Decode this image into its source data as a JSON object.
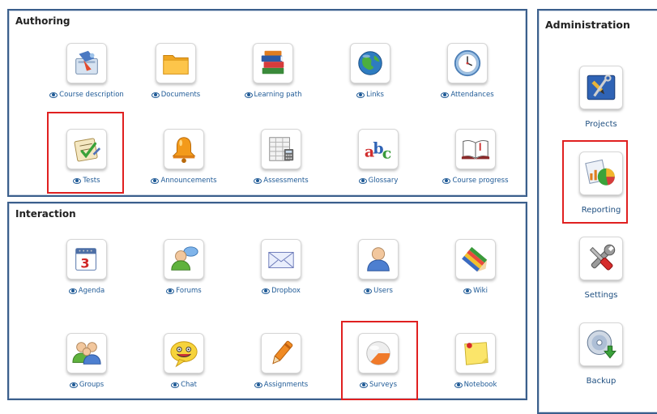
{
  "authoring": {
    "title": "Authoring",
    "tools": [
      {
        "label": "Course description",
        "icon": "course-description-icon"
      },
      {
        "label": "Documents",
        "icon": "folder-icon"
      },
      {
        "label": "Learning path",
        "icon": "books-icon"
      },
      {
        "label": "Links",
        "icon": "globe-icon"
      },
      {
        "label": "Attendances",
        "icon": "clock-icon"
      },
      {
        "label": "Tests",
        "icon": "test-checklist-icon"
      },
      {
        "label": "Announcements",
        "icon": "bell-icon"
      },
      {
        "label": "Assessments",
        "icon": "spreadsheet-icon"
      },
      {
        "label": "Glossary",
        "icon": "abc-icon"
      },
      {
        "label": "Course progress",
        "icon": "open-book-icon"
      }
    ]
  },
  "interaction": {
    "title": "Interaction",
    "tools": [
      {
        "label": "Agenda",
        "icon": "calendar-icon"
      },
      {
        "label": "Forums",
        "icon": "forum-person-icon"
      },
      {
        "label": "Dropbox",
        "icon": "envelope-icon"
      },
      {
        "label": "Users",
        "icon": "user-icon"
      },
      {
        "label": "Wiki",
        "icon": "pencils-icon"
      },
      {
        "label": "Groups",
        "icon": "group-icon"
      },
      {
        "label": "Chat",
        "icon": "chat-smiley-icon"
      },
      {
        "label": "Assignments",
        "icon": "marker-icon"
      },
      {
        "label": "Surveys",
        "icon": "survey-pie-icon"
      },
      {
        "label": "Notebook",
        "icon": "sticky-note-icon"
      }
    ]
  },
  "administration": {
    "title": "Administration",
    "tools": [
      {
        "label": "Projects",
        "icon": "projects-tools-icon"
      },
      {
        "label": "Reporting",
        "icon": "reporting-chart-icon"
      },
      {
        "label": "Settings",
        "icon": "wrench-screwdriver-icon"
      },
      {
        "label": "Backup",
        "icon": "backup-disc-icon"
      }
    ]
  },
  "highlight_color": "#e02020",
  "link_color": "#1f5a96"
}
